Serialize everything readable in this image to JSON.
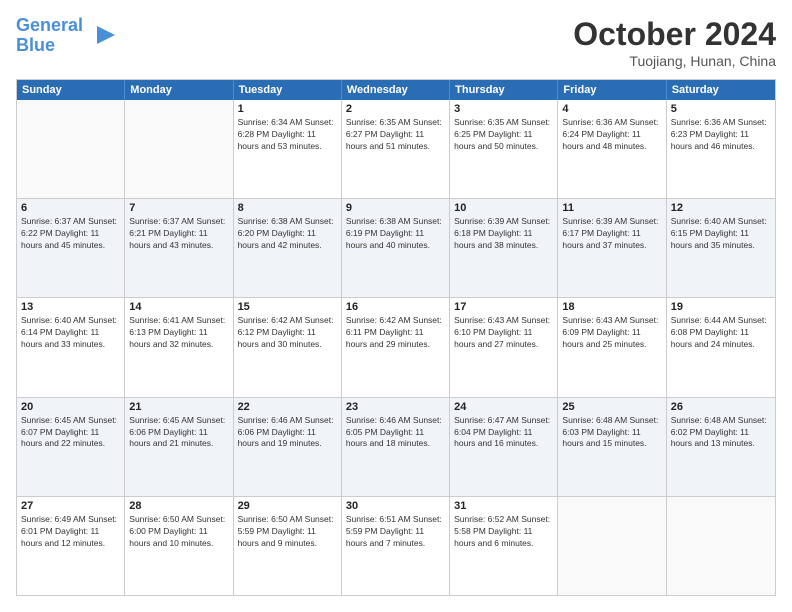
{
  "logo": {
    "line1": "General",
    "line2": "Blue"
  },
  "title": "October 2024",
  "subtitle": "Tuojiang, Hunan, China",
  "weekdays": [
    "Sunday",
    "Monday",
    "Tuesday",
    "Wednesday",
    "Thursday",
    "Friday",
    "Saturday"
  ],
  "weeks": [
    [
      {
        "day": "",
        "info": ""
      },
      {
        "day": "",
        "info": ""
      },
      {
        "day": "1",
        "info": "Sunrise: 6:34 AM\nSunset: 6:28 PM\nDaylight: 11 hours and 53 minutes."
      },
      {
        "day": "2",
        "info": "Sunrise: 6:35 AM\nSunset: 6:27 PM\nDaylight: 11 hours and 51 minutes."
      },
      {
        "day": "3",
        "info": "Sunrise: 6:35 AM\nSunset: 6:25 PM\nDaylight: 11 hours and 50 minutes."
      },
      {
        "day": "4",
        "info": "Sunrise: 6:36 AM\nSunset: 6:24 PM\nDaylight: 11 hours and 48 minutes."
      },
      {
        "day": "5",
        "info": "Sunrise: 6:36 AM\nSunset: 6:23 PM\nDaylight: 11 hours and 46 minutes."
      }
    ],
    [
      {
        "day": "6",
        "info": "Sunrise: 6:37 AM\nSunset: 6:22 PM\nDaylight: 11 hours and 45 minutes."
      },
      {
        "day": "7",
        "info": "Sunrise: 6:37 AM\nSunset: 6:21 PM\nDaylight: 11 hours and 43 minutes."
      },
      {
        "day": "8",
        "info": "Sunrise: 6:38 AM\nSunset: 6:20 PM\nDaylight: 11 hours and 42 minutes."
      },
      {
        "day": "9",
        "info": "Sunrise: 6:38 AM\nSunset: 6:19 PM\nDaylight: 11 hours and 40 minutes."
      },
      {
        "day": "10",
        "info": "Sunrise: 6:39 AM\nSunset: 6:18 PM\nDaylight: 11 hours and 38 minutes."
      },
      {
        "day": "11",
        "info": "Sunrise: 6:39 AM\nSunset: 6:17 PM\nDaylight: 11 hours and 37 minutes."
      },
      {
        "day": "12",
        "info": "Sunrise: 6:40 AM\nSunset: 6:15 PM\nDaylight: 11 hours and 35 minutes."
      }
    ],
    [
      {
        "day": "13",
        "info": "Sunrise: 6:40 AM\nSunset: 6:14 PM\nDaylight: 11 hours and 33 minutes."
      },
      {
        "day": "14",
        "info": "Sunrise: 6:41 AM\nSunset: 6:13 PM\nDaylight: 11 hours and 32 minutes."
      },
      {
        "day": "15",
        "info": "Sunrise: 6:42 AM\nSunset: 6:12 PM\nDaylight: 11 hours and 30 minutes."
      },
      {
        "day": "16",
        "info": "Sunrise: 6:42 AM\nSunset: 6:11 PM\nDaylight: 11 hours and 29 minutes."
      },
      {
        "day": "17",
        "info": "Sunrise: 6:43 AM\nSunset: 6:10 PM\nDaylight: 11 hours and 27 minutes."
      },
      {
        "day": "18",
        "info": "Sunrise: 6:43 AM\nSunset: 6:09 PM\nDaylight: 11 hours and 25 minutes."
      },
      {
        "day": "19",
        "info": "Sunrise: 6:44 AM\nSunset: 6:08 PM\nDaylight: 11 hours and 24 minutes."
      }
    ],
    [
      {
        "day": "20",
        "info": "Sunrise: 6:45 AM\nSunset: 6:07 PM\nDaylight: 11 hours and 22 minutes."
      },
      {
        "day": "21",
        "info": "Sunrise: 6:45 AM\nSunset: 6:06 PM\nDaylight: 11 hours and 21 minutes."
      },
      {
        "day": "22",
        "info": "Sunrise: 6:46 AM\nSunset: 6:06 PM\nDaylight: 11 hours and 19 minutes."
      },
      {
        "day": "23",
        "info": "Sunrise: 6:46 AM\nSunset: 6:05 PM\nDaylight: 11 hours and 18 minutes."
      },
      {
        "day": "24",
        "info": "Sunrise: 6:47 AM\nSunset: 6:04 PM\nDaylight: 11 hours and 16 minutes."
      },
      {
        "day": "25",
        "info": "Sunrise: 6:48 AM\nSunset: 6:03 PM\nDaylight: 11 hours and 15 minutes."
      },
      {
        "day": "26",
        "info": "Sunrise: 6:48 AM\nSunset: 6:02 PM\nDaylight: 11 hours and 13 minutes."
      }
    ],
    [
      {
        "day": "27",
        "info": "Sunrise: 6:49 AM\nSunset: 6:01 PM\nDaylight: 11 hours and 12 minutes."
      },
      {
        "day": "28",
        "info": "Sunrise: 6:50 AM\nSunset: 6:00 PM\nDaylight: 11 hours and 10 minutes."
      },
      {
        "day": "29",
        "info": "Sunrise: 6:50 AM\nSunset: 5:59 PM\nDaylight: 11 hours and 9 minutes."
      },
      {
        "day": "30",
        "info": "Sunrise: 6:51 AM\nSunset: 5:59 PM\nDaylight: 11 hours and 7 minutes."
      },
      {
        "day": "31",
        "info": "Sunrise: 6:52 AM\nSunset: 5:58 PM\nDaylight: 11 hours and 6 minutes."
      },
      {
        "day": "",
        "info": ""
      },
      {
        "day": "",
        "info": ""
      }
    ]
  ]
}
